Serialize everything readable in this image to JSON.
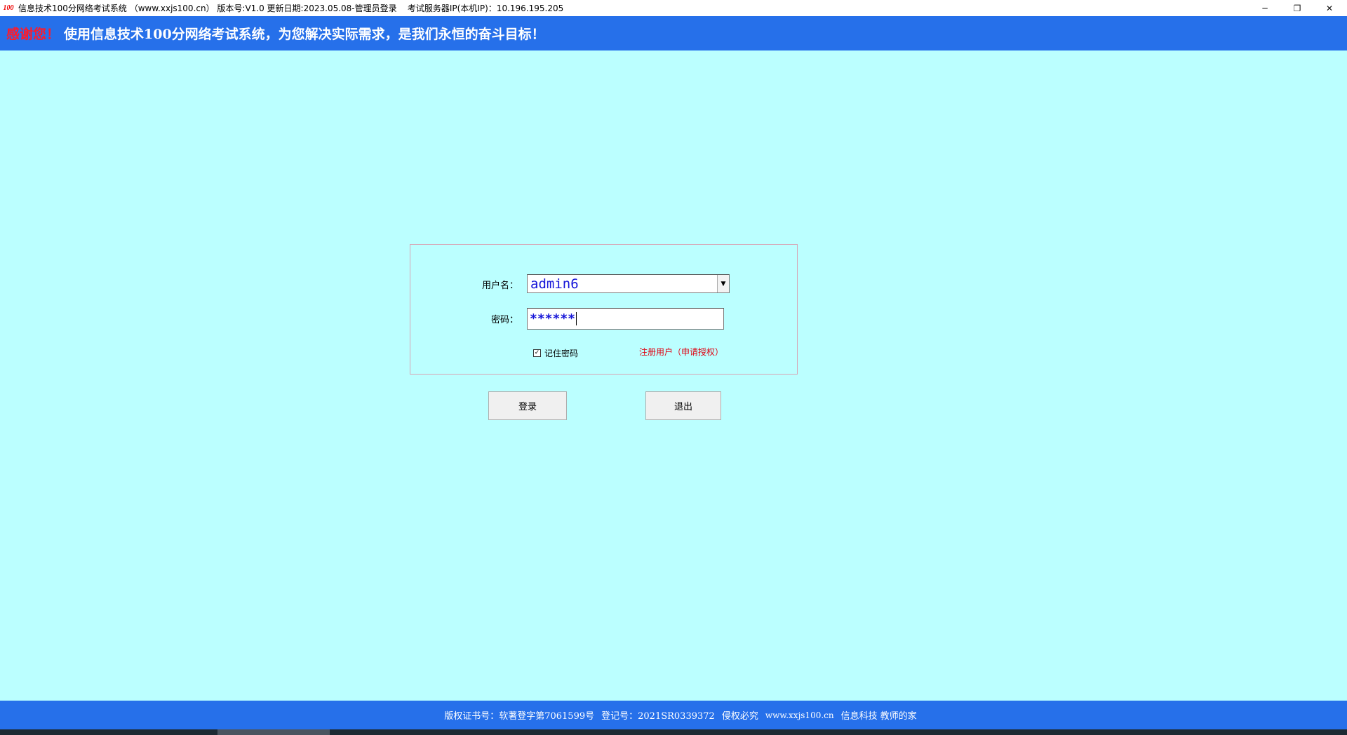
{
  "window": {
    "icon_text": "100",
    "title": "信息技术100分网络考试系统 （www.xxjs100.cn） 版本号:V1.0 更新日期:2023.05.08-管理员登录    考试服务器IP(本机IP)：10.196.195.205",
    "minimize_glyph": "─",
    "maximize_glyph": "❐",
    "close_glyph": "✕"
  },
  "banner": {
    "thanks": "感谢您！",
    "slogan": "使用信息技术100分网络考试系统，为您解决实际需求，是我们永恒的奋斗目标！"
  },
  "login": {
    "username_label": "用户名：",
    "username_value": "admin6",
    "password_label": "密码：",
    "password_value": "******",
    "remember_label": "记住密码",
    "remember_checked": "✓",
    "register_link": "注册用户（申请授权）",
    "login_button": "登录",
    "exit_button": "退出"
  },
  "footer": {
    "copyright": "版权证书号：软著登字第7061599号",
    "registration": "登记号：2021SR0339372",
    "notice": "侵权必究",
    "website": "www.xxjs100.cn",
    "brand": "信息科技 教师的家"
  },
  "colors": {
    "background": "#bbffff",
    "banner": "#2670ea",
    "thanks_red": "#ff1a2a",
    "input_text_blue": "#1515d8",
    "register_red": "#e00010"
  }
}
